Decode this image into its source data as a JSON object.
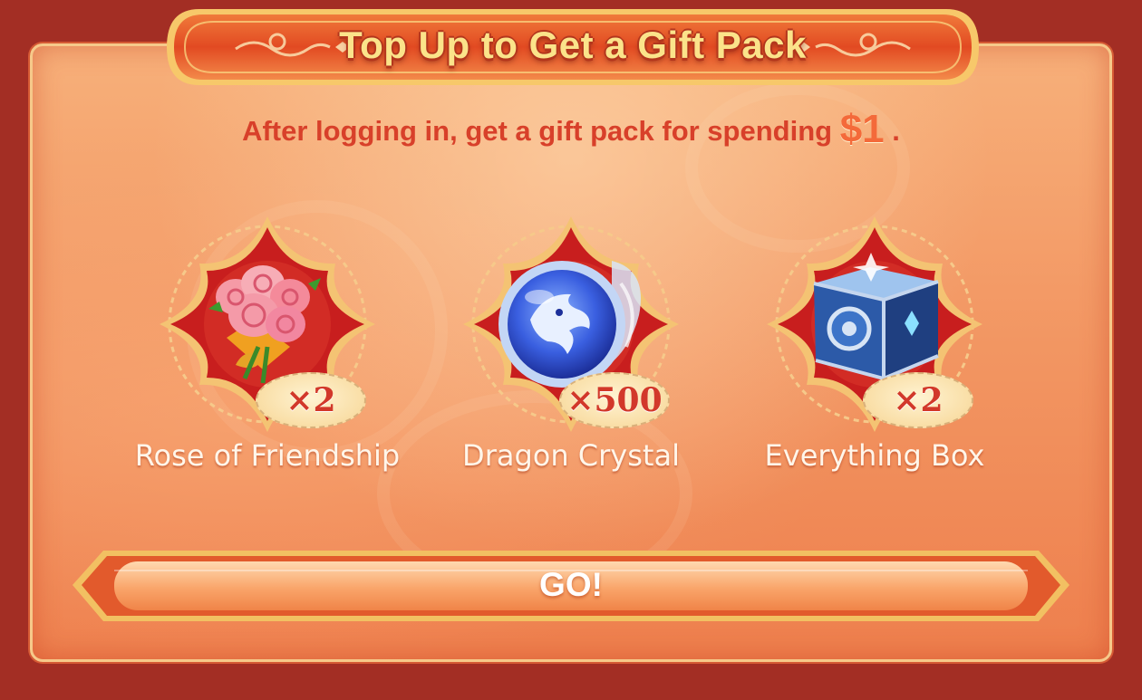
{
  "title": "Top Up to Get a Gift Pack",
  "subtitle": {
    "prefix": "After logging in, get a gift pack for spending",
    "amount": "$1",
    "suffix": "."
  },
  "rewards": [
    {
      "name": "Rose of Friendship",
      "count": "×2",
      "icon": "rose-bouquet-icon"
    },
    {
      "name": "Dragon Crystal",
      "count": "×500",
      "icon": "dragon-crystal-icon"
    },
    {
      "name": "Everything Box",
      "count": "×2",
      "icon": "everything-box-icon"
    }
  ],
  "go_button": {
    "label": "GO!"
  },
  "colors": {
    "background": "#a32e24",
    "panel": "#f39a66",
    "title_text": "#fbe38a",
    "accent_red": "#d8402a",
    "frame_red": "#c81e1e",
    "gold": "#f2c062"
  }
}
